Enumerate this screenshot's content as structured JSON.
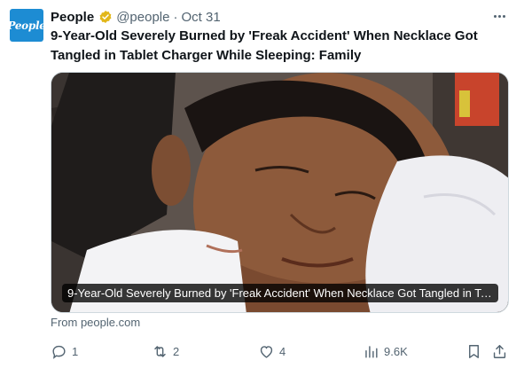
{
  "tweet": {
    "avatar_text": "People",
    "author_name": "People",
    "handle": "@people",
    "date": "Oct 31",
    "text": "9-Year-Old Severely Burned by 'Freak Accident' When Necklace Got Tangled in Tablet Charger While Sleeping: Family",
    "card_caption": "9-Year-Old Severely Burned by 'Freak Accident' When Necklace Got Tangled in Ta...",
    "card_source": "From people.com",
    "stats": {
      "replies": "1",
      "retweets": "2",
      "likes": "4",
      "views": "9.6K"
    }
  },
  "colors": {
    "brand": "#1d8cd3",
    "verified_gold": "#e2b719",
    "muted_text": "#536471",
    "primary_text": "#0f1419"
  },
  "icons": [
    "verified-badge-icon",
    "more-icon",
    "reply-icon",
    "retweet-icon",
    "like-icon",
    "views-icon",
    "bookmark-icon",
    "share-icon"
  ]
}
